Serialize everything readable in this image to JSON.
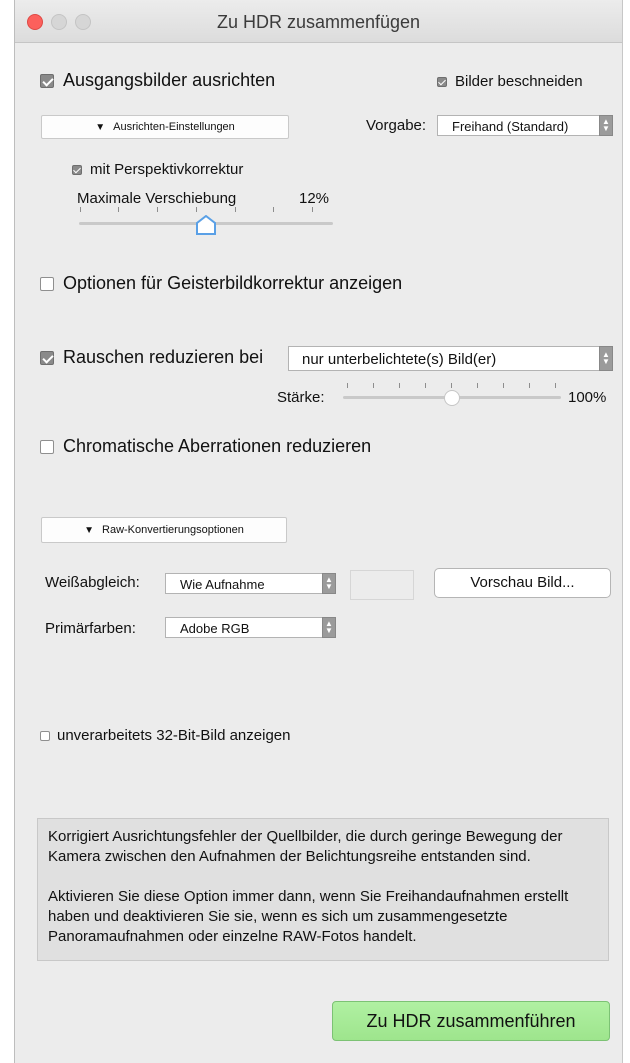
{
  "window": {
    "title": "Zu HDR zusammenfügen"
  },
  "align": {
    "label": "Ausgangsbilder ausrichten",
    "checked": true,
    "settings_button": "Ausrichten-Einstellungen",
    "perspective_label": "mit Perspektivkorrektur",
    "perspective_checked": true,
    "max_shift_label": "Maximale Verschiebung",
    "max_shift_value": "12%",
    "max_shift_fraction": 0.5
  },
  "crop": {
    "label": "Bilder beschneiden",
    "checked": true
  },
  "preset": {
    "label": "Vorgabe:",
    "value": "Freihand (Standard)"
  },
  "ghost": {
    "label": "Optionen für Geisterbildkorrektur anzeigen",
    "checked": false
  },
  "noise": {
    "label": "Rauschen reduzieren bei",
    "checked": true,
    "select_value": "nur unterbelichtete(s) Bild(er)",
    "strength_label": "Stärke:",
    "strength_value": "100%",
    "strength_fraction": 0.5
  },
  "chromatic": {
    "label": "Chromatische Aberrationen reduzieren",
    "checked": false
  },
  "raw": {
    "options_button": "Raw-Konvertierungsoptionen",
    "white_balance_label": "Weißabgleich:",
    "white_balance_value": "Wie Aufnahme",
    "preview_button": "Vorschau Bild...",
    "primaries_label": "Primärfarben:",
    "primaries_value": "Adobe RGB"
  },
  "raw32": {
    "label": "unverarbeitets 32-Bit-Bild anzeigen",
    "checked": false
  },
  "info": {
    "para1": "Korrigiert Ausrichtungsfehler der Quellbilder, die durch geringe Bewegung der Kamera zwischen den Aufnahmen der Belichtungsreihe entstanden sind.",
    "para2": "Aktivieren Sie diese Option immer dann, wenn Sie Freihandaufnahmen erstellt haben und deaktivieren Sie sie, wenn es sich um zusammengesetzte Panoramaufnahmen oder einzelne RAW-Fotos handelt."
  },
  "merge_button": "Zu HDR zusammenführen",
  "colors": {
    "close": "#fc605c",
    "primary": "#a5ea95",
    "checkbox": "#8a8a8a"
  }
}
